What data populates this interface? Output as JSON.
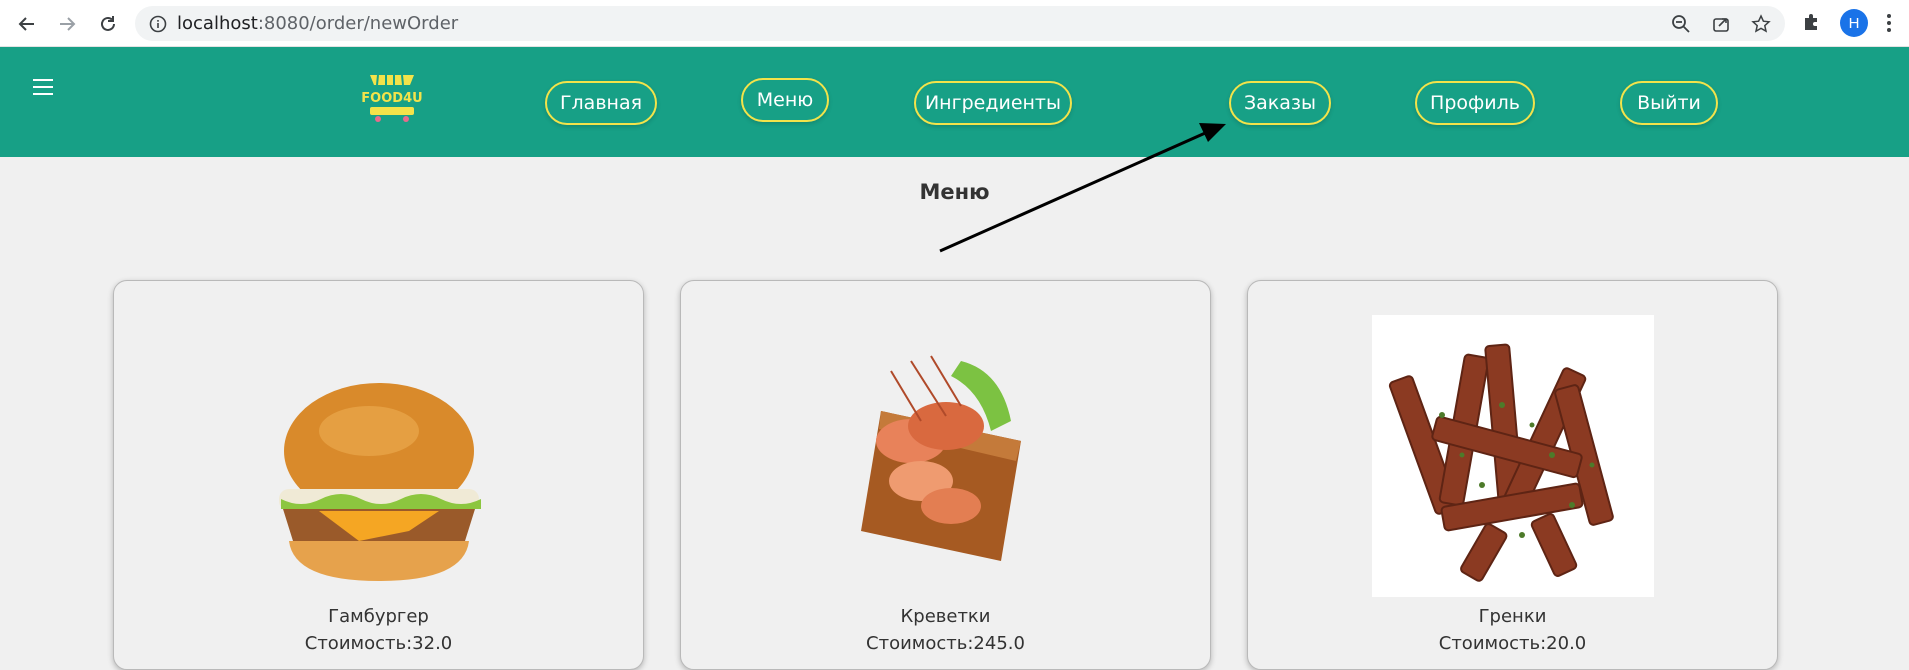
{
  "browser": {
    "url_host": "localhost",
    "url_path": ":8080/order/newOrder",
    "profile_initial": "H"
  },
  "header": {
    "logo_text": "FOOD4U",
    "nav": [
      {
        "label": "Главная"
      },
      {
        "label": "Меню"
      },
      {
        "label": "Ингредиенты"
      },
      {
        "label": "Заказы"
      },
      {
        "label": "Профиль"
      },
      {
        "label": "Выйти"
      }
    ]
  },
  "main": {
    "title": "Меню",
    "items": [
      {
        "name": "Гамбургер",
        "price": "Стоимость:32.0"
      },
      {
        "name": "Креветки",
        "price": "Стоимость:245.0"
      },
      {
        "name": "Гренки",
        "price": "Стоимость:20.0"
      }
    ]
  },
  "colors": {
    "header_bg": "#17a086",
    "pill_border": "#f3e34a",
    "page_bg": "#f0f0f0"
  }
}
